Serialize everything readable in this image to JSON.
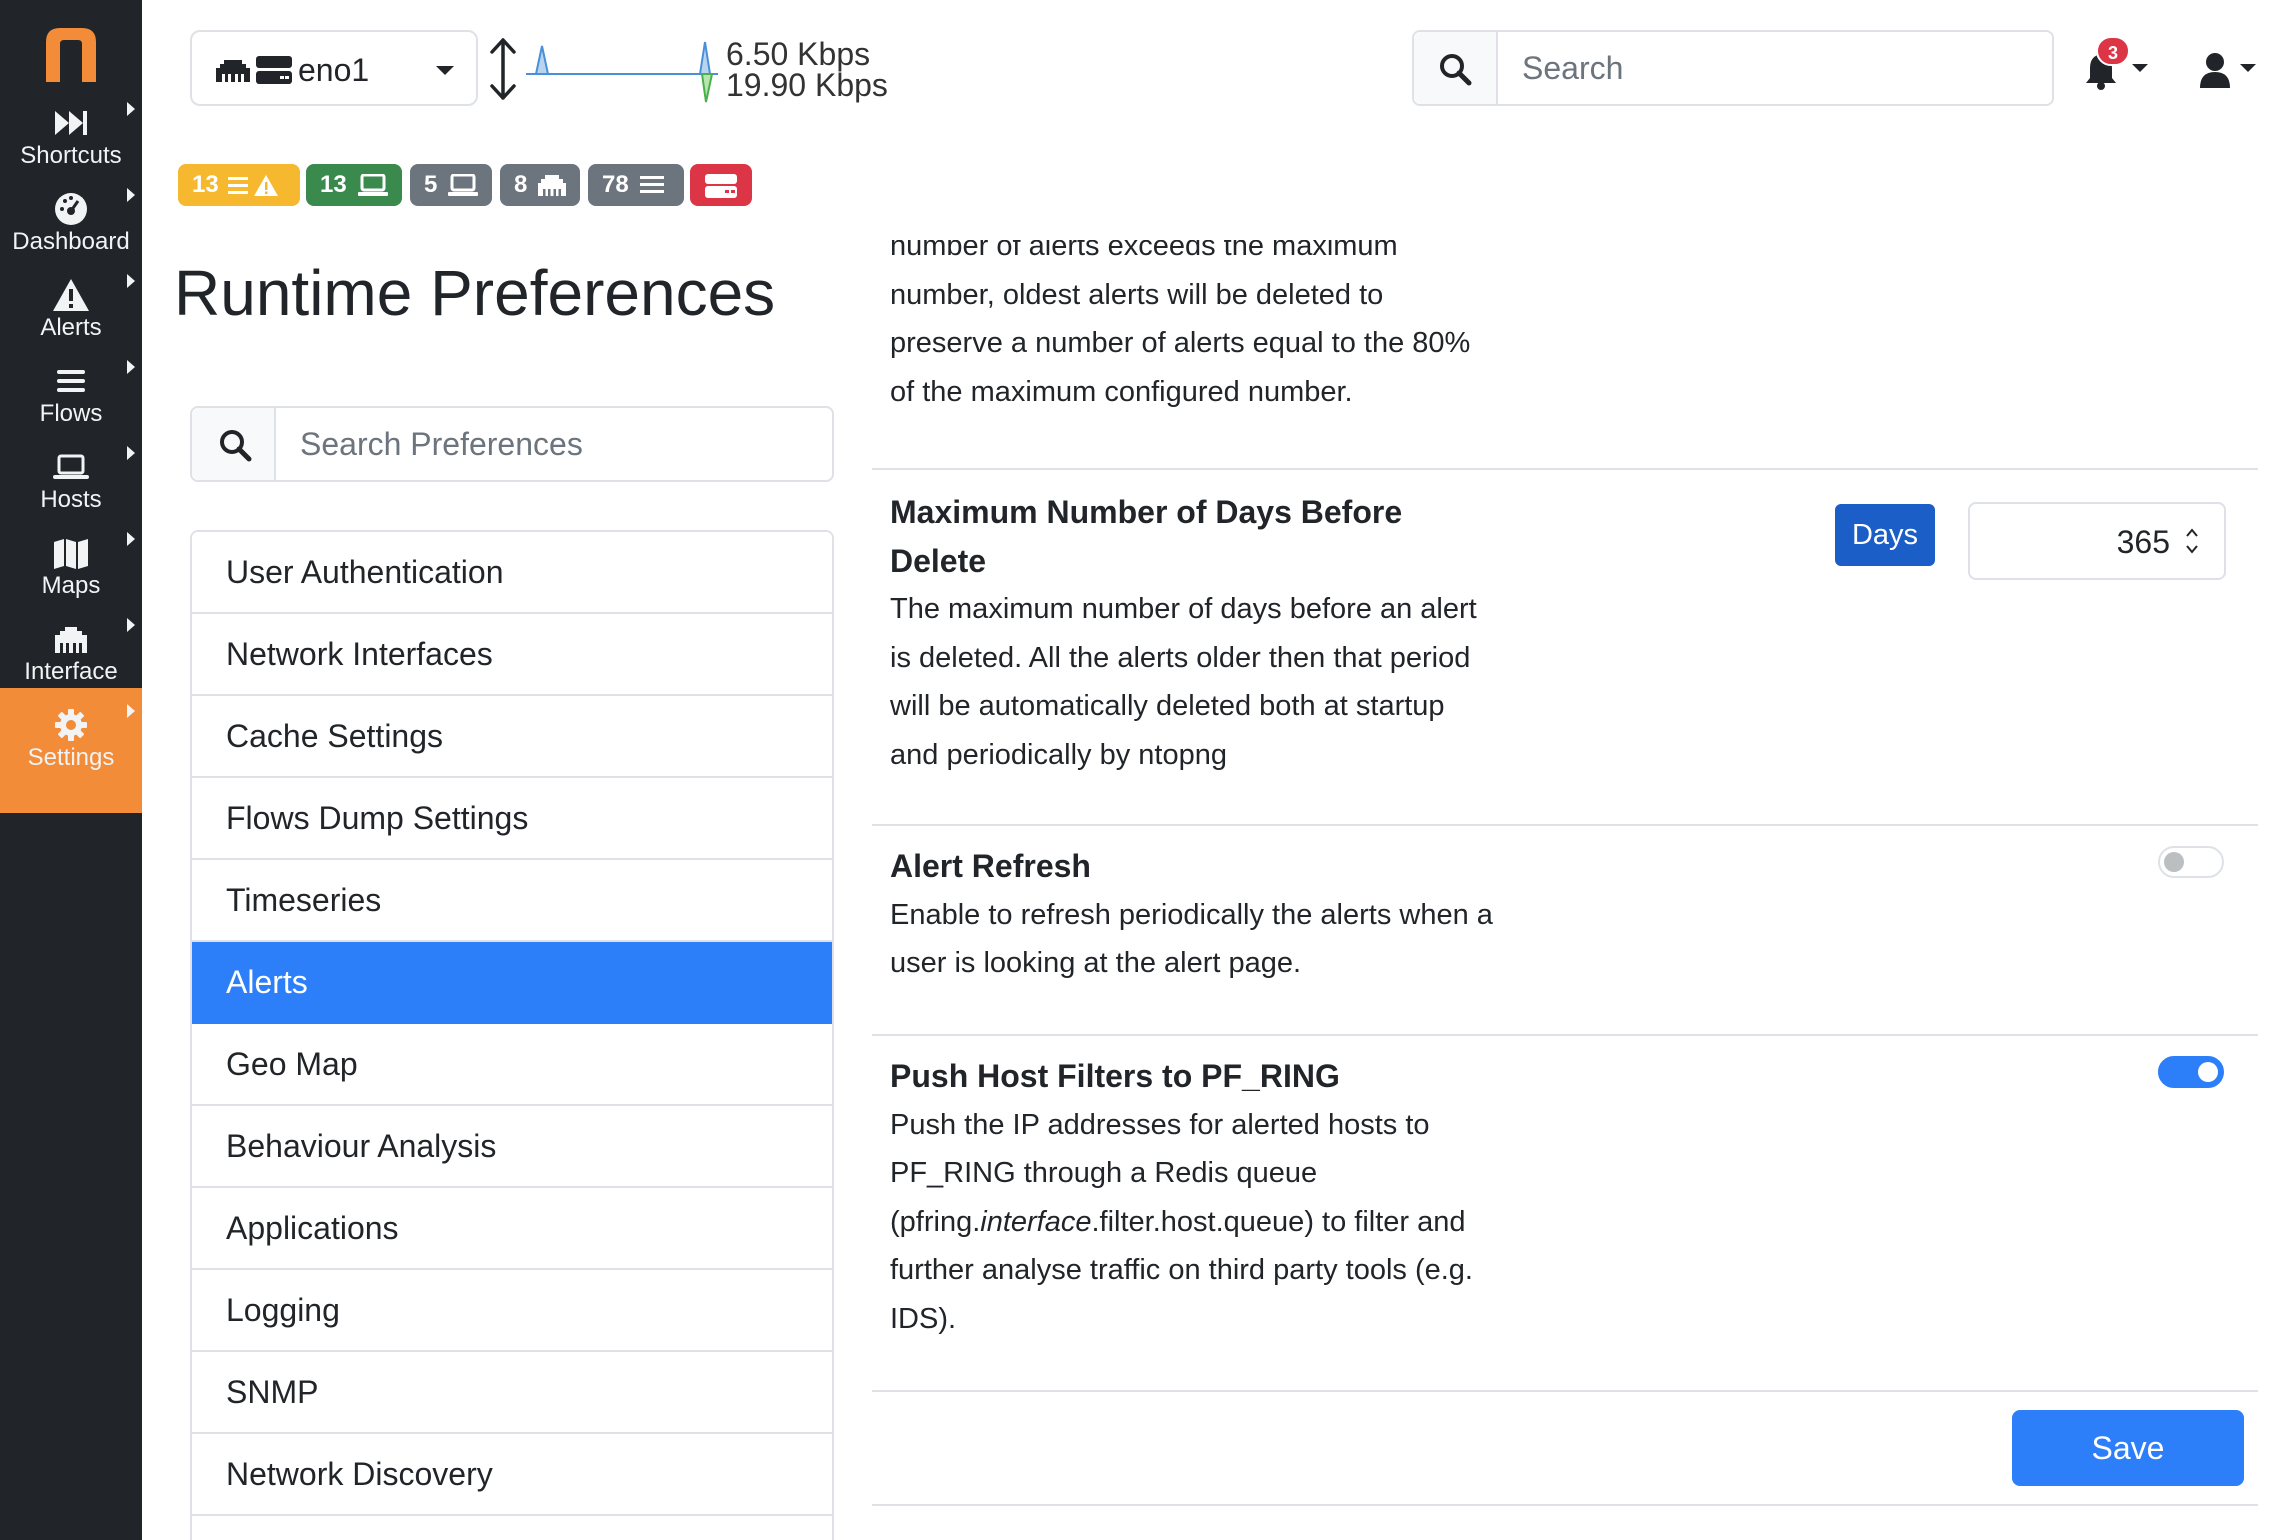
{
  "sidebar": {
    "items": [
      {
        "label": "Shortcuts",
        "icon": "fast-forward-icon"
      },
      {
        "label": "Dashboard",
        "icon": "gauge-icon"
      },
      {
        "label": "Alerts",
        "icon": "warning-icon"
      },
      {
        "label": "Flows",
        "icon": "bars-icon"
      },
      {
        "label": "Hosts",
        "icon": "laptop-icon"
      },
      {
        "label": "Maps",
        "icon": "map-icon"
      },
      {
        "label": "Interface",
        "icon": "ethernet-icon"
      },
      {
        "label": "Settings",
        "icon": "gear-icon"
      }
    ],
    "active": "Settings",
    "accent_color": "#f28c38"
  },
  "topbar": {
    "interface_name": "eno1",
    "throughput_up": "6.50 Kbps",
    "throughput_down": "19.90 Kbps",
    "search_placeholder": "Search",
    "notification_count": "3"
  },
  "badges": [
    {
      "count": "13",
      "color": "#f5b82e",
      "icon": "bars-warning-icon"
    },
    {
      "count": "13",
      "color": "#3a8a4d",
      "icon": "laptop-icon"
    },
    {
      "count": "5",
      "color": "#6c757d",
      "icon": "laptop-icon"
    },
    {
      "count": "8",
      "color": "#6c757d",
      "icon": "ethernet-icon"
    },
    {
      "count": "78",
      "color": "#6c757d",
      "icon": "bars-icon"
    },
    {
      "count": "",
      "color": "#dc3545",
      "icon": "hdd-icon"
    }
  ],
  "page": {
    "title": "Runtime Preferences",
    "search_placeholder": "Search Preferences"
  },
  "categories": [
    "User Authentication",
    "Network Interfaces",
    "Cache Settings",
    "Flows Dump Settings",
    "Timeseries",
    "Alerts",
    "Geo Map",
    "Behaviour Analysis",
    "Applications",
    "Logging",
    "SNMP",
    "Network Discovery"
  ],
  "active_category": "Alerts",
  "prefs": {
    "truncated_desc": {
      "line0": "number of alerts exceeds the maximum",
      "line1": "number, oldest alerts will be deleted to",
      "line2": "preserve a number of alerts equal to the 80%",
      "line3": "of the maximum configured number."
    },
    "max_days": {
      "title_line1": "Maximum Number of Days Before",
      "title_line2": "Delete",
      "desc_line1": "The maximum number of days before an alert",
      "desc_line2": "is deleted. All the alerts older then that period",
      "desc_line3": "will be automatically deleted both at startup",
      "desc_line4": "and periodically by ntopng",
      "unit_label": "Days",
      "value": "365"
    },
    "alert_refresh": {
      "title": "Alert Refresh",
      "desc_line1": "Enable to refresh periodically the alerts when a",
      "desc_line2": "user is looking at the alert page.",
      "enabled": false
    },
    "push_host_filters": {
      "title": "Push Host Filters to PF_RING",
      "desc_line1": "Push the IP addresses for alerted hosts to",
      "desc_line2": "PF_RING through a Redis queue",
      "desc_line3_pre": "(pfring.",
      "desc_line3_italic": "interface",
      "desc_line3_post": ".filter.host.queue) to filter and",
      "desc_line4": "further analyse traffic on third party tools (e.g.",
      "desc_line5": "IDS).",
      "enabled": true
    }
  },
  "save_label": "Save"
}
